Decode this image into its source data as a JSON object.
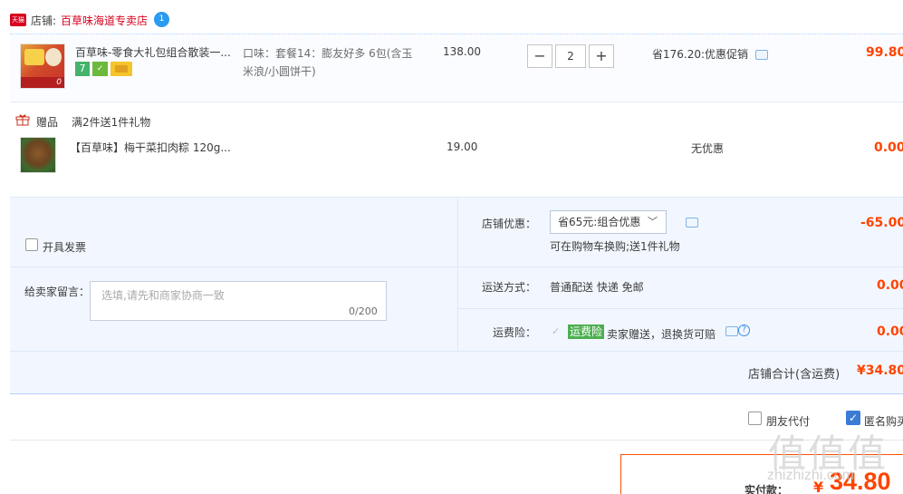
{
  "store": {
    "badge": "天猫",
    "label": "店铺:",
    "name": "百草味海道专卖店",
    "ww": "1"
  },
  "items": [
    {
      "title": "百草味-零食大礼包组合散装一...",
      "sku": "口味：套餐14：膨友好多 6包(含玉米浪/小圆饼干)",
      "price": "138.00",
      "quantity": "2",
      "promo": "省176.20:优惠促销",
      "subtotal": "99.80",
      "thumb_badge": "0",
      "service_icon": "7"
    },
    {
      "title": "【百草味】梅干菜扣肉粽 120g...",
      "price": "19.00",
      "promo": "无优惠",
      "subtotal": "0.00"
    }
  ],
  "gift": {
    "label": "赠品",
    "rule": "满2件送1件礼物"
  },
  "invoice": {
    "label": "开具发票"
  },
  "message": {
    "label": "给卖家留言：",
    "placeholder": "选填,请先和商家协商一致",
    "count": "0/200"
  },
  "shop_discount": {
    "label": "店铺优惠：",
    "selected": "省65元:组合优惠",
    "note": "可在购物车换购;送1件礼物",
    "amount": "-65.00"
  },
  "shipping": {
    "label": "运送方式：",
    "value": "普通配送 快递 免邮",
    "amount": "0.00"
  },
  "insurance": {
    "label": "运费险：",
    "tag": "运费险",
    "desc": "卖家赠送，退换货可赔",
    "amount": "0.00"
  },
  "total": {
    "label": "店铺合计(含运费)",
    "amount": "¥34.80"
  },
  "bottom": {
    "friend_pay": "朋友代付",
    "anonymous": "匿名购买",
    "pay_label": "实付款：",
    "currency": "¥",
    "pay_amount": "34.80"
  },
  "watermark": {
    "logo": "值值值",
    "url": "zhizhizhi.com"
  },
  "colors": {
    "price_red": "#ff4400",
    "store_red": "#d6001c",
    "panel_bg": "#f2f7ff",
    "insurance_green": "#4caf50"
  }
}
